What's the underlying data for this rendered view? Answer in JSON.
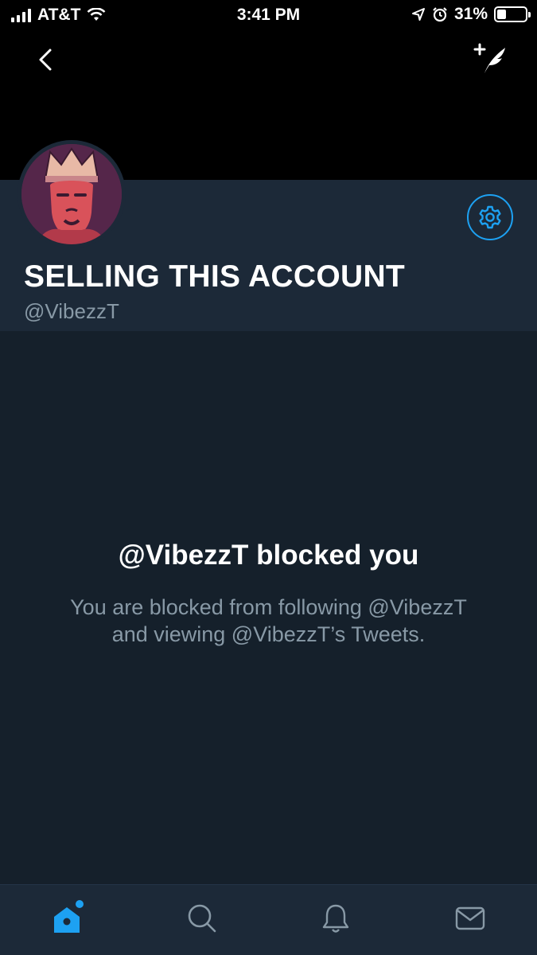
{
  "status_bar": {
    "carrier": "AT&T",
    "time": "3:41 PM",
    "battery": "31%",
    "battery_level": 0.31,
    "icons": [
      "signal-icon",
      "wifi-icon",
      "location-icon",
      "alarm-icon",
      "battery-icon"
    ]
  },
  "header": {
    "icons": [
      "back-icon",
      "compose-tweet-icon"
    ]
  },
  "profile": {
    "display_name": "SELLING THIS ACCOUNT",
    "handle": "@VibezzT",
    "icons": [
      "avatar",
      "gear-icon"
    ]
  },
  "blocked": {
    "title": "@VibezzT blocked you",
    "message": "You are blocked from following @VibezzT and viewing @VibezzT’s Tweets."
  },
  "tab_bar": {
    "tabs": [
      {
        "name": "home",
        "icon": "home-icon",
        "active": true
      },
      {
        "name": "search",
        "icon": "search-icon",
        "active": false
      },
      {
        "name": "notifications",
        "icon": "bell-icon",
        "active": false
      },
      {
        "name": "messages",
        "icon": "envelope-icon",
        "active": false
      }
    ]
  },
  "colors": {
    "accent": "#1da1f2",
    "background": "#15202b",
    "profile_panel": "#1c2938",
    "secondary_text": "#8899a6"
  }
}
